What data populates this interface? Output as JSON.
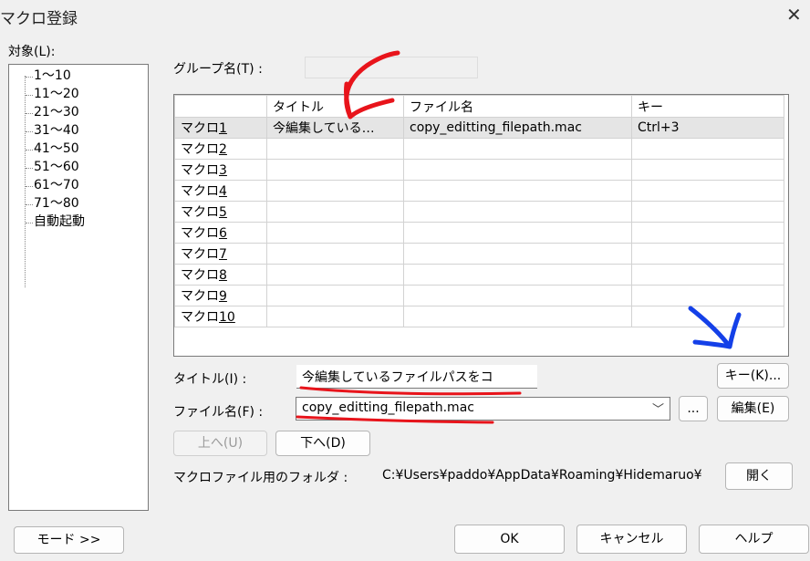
{
  "window": {
    "title": "マクロ登録"
  },
  "target": {
    "label": "対象(L):",
    "items": [
      "1～10",
      "11～20",
      "21～30",
      "31～40",
      "41～50",
      "51～60",
      "61～70",
      "71～80",
      "自動起動"
    ]
  },
  "group": {
    "label": "グループ名(T) :",
    "value": ""
  },
  "grid": {
    "headers": [
      "タイトル",
      "ファイル名",
      "キー"
    ],
    "rows": [
      {
        "name_prefix": "マクロ",
        "name_num": "1",
        "title": "今編集している…",
        "file": "copy_editting_filepath.mac",
        "key": "Ctrl+3"
      },
      {
        "name_prefix": "マクロ",
        "name_num": "2",
        "title": "",
        "file": "",
        "key": ""
      },
      {
        "name_prefix": "マクロ",
        "name_num": "3",
        "title": "",
        "file": "",
        "key": ""
      },
      {
        "name_prefix": "マクロ",
        "name_num": "4",
        "title": "",
        "file": "",
        "key": ""
      },
      {
        "name_prefix": "マクロ",
        "name_num": "5",
        "title": "",
        "file": "",
        "key": ""
      },
      {
        "name_prefix": "マクロ",
        "name_num": "6",
        "title": "",
        "file": "",
        "key": ""
      },
      {
        "name_prefix": "マクロ",
        "name_num": "7",
        "title": "",
        "file": "",
        "key": ""
      },
      {
        "name_prefix": "マクロ",
        "name_num": "8",
        "title": "",
        "file": "",
        "key": ""
      },
      {
        "name_prefix": "マクロ",
        "name_num": "9",
        "title": "",
        "file": "",
        "key": ""
      },
      {
        "name_prefix": "マクロ",
        "name_num": "10",
        "title": "",
        "file": "",
        "key": ""
      }
    ]
  },
  "title_field": {
    "label": "タイトル(I) :",
    "value": "今編集しているファイルパスをコ"
  },
  "file_field": {
    "label": "ファイル名(F) :",
    "value": "copy_editting_filepath.mac"
  },
  "buttons": {
    "key": "キー(K)...",
    "browse": "...",
    "edit": "編集(E)",
    "up": "上へ(U)",
    "down": "下へ(D)",
    "open": "開く",
    "mode": "モード >>",
    "ok": "OK",
    "cancel": "キャンセル",
    "help": "ヘルプ"
  },
  "folder": {
    "label": "マクロファイル用のフォルダ :",
    "path": "C:¥Users¥paddo¥AppData¥Roaming¥Hidemaruo¥"
  },
  "colors": {
    "annotation_red": "#e8141b",
    "annotation_blue": "#1440e8"
  }
}
